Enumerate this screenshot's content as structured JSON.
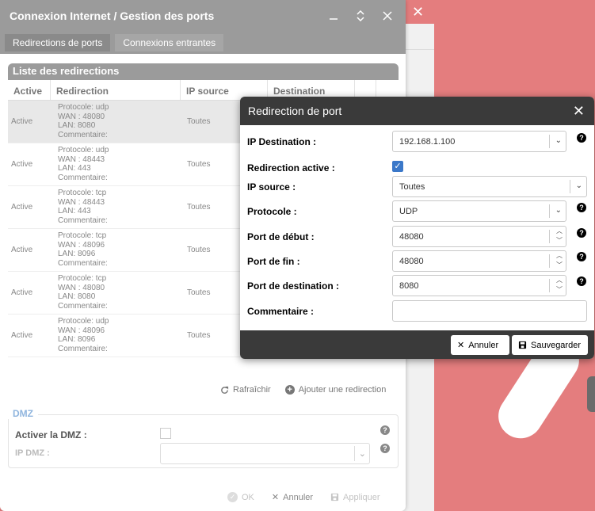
{
  "main_window": {
    "title": "Connexion Internet / Gestion des ports",
    "tabs": [
      {
        "label": "Redirections de ports"
      },
      {
        "label": "Connexions entrantes"
      }
    ],
    "list_title": "Liste des redirections",
    "columns": [
      "Active",
      "Redirection",
      "IP source",
      "Destination"
    ],
    "rows": [
      {
        "active": "Active",
        "redir": "Protocole: udp\nWAN : 48080\nLAN: 8080\nCommentaire:",
        "ip": "Toutes"
      },
      {
        "active": "Active",
        "redir": "Protocole: udp\nWAN : 48443\nLAN: 443\nCommentaire:",
        "ip": "Toutes"
      },
      {
        "active": "Active",
        "redir": "Protocole: tcp\nWAN : 48443\nLAN: 443\nCommentaire:",
        "ip": "Toutes"
      },
      {
        "active": "Active",
        "redir": "Protocole: tcp\nWAN : 48096\nLAN: 8096\nCommentaire:",
        "ip": "Toutes"
      },
      {
        "active": "Active",
        "redir": "Protocole: tcp\nWAN : 48080\nLAN: 8080\nCommentaire:",
        "ip": "Toutes"
      },
      {
        "active": "Active",
        "redir": "Protocole: udp\nWAN : 48096\nLAN: 8096\nCommentaire:",
        "ip": "Toutes"
      }
    ],
    "refresh_label": "Rafraîchir",
    "add_label": "Ajouter une redirection",
    "dmz": {
      "legend": "DMZ",
      "activate_label": "Activer la DMZ :",
      "ip_label": "IP DMZ :"
    },
    "footer": {
      "ok": "OK",
      "cancel": "Annuler",
      "apply": "Appliquer"
    }
  },
  "dialog": {
    "title": "Redirection de port",
    "fields": {
      "ip_destination": {
        "label": "IP Destination :",
        "value": "192.168.1.100"
      },
      "active": {
        "label": "Redirection active :",
        "checked": true
      },
      "ip_source": {
        "label": "IP source :",
        "value": "Toutes"
      },
      "protocol": {
        "label": "Protocole :",
        "value": "UDP"
      },
      "port_start": {
        "label": "Port de début :",
        "value": "48080"
      },
      "port_end": {
        "label": "Port de fin :",
        "value": "48080"
      },
      "port_dest": {
        "label": "Port de destination :",
        "value": "8080"
      },
      "comment": {
        "label": "Commentaire :",
        "value": ""
      }
    },
    "cancel_label": "Annuler",
    "save_label": "Sauvegarder"
  }
}
